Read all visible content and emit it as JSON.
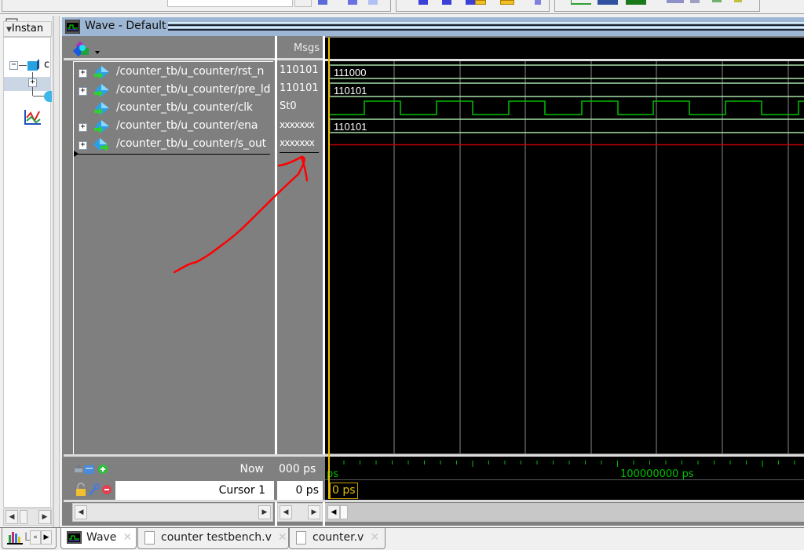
{
  "wave_window": {
    "title": "Wave - Default",
    "msgs_header": "Msgs"
  },
  "instance_panel": {
    "header": "Instan",
    "tree_items": [
      "c"
    ]
  },
  "signals": [
    {
      "name": "/counter_tb/u_counter/rst_n",
      "value": "110101",
      "expandable": true,
      "wave_type": "bus",
      "wave_label": "111000",
      "direction": "in"
    },
    {
      "name": "/counter_tb/u_counter/pre_ld",
      "value": "110101",
      "expandable": true,
      "wave_type": "bus",
      "wave_label": "110101",
      "direction": "in"
    },
    {
      "name": "/counter_tb/u_counter/clk",
      "value": "St0",
      "expandable": false,
      "wave_type": "clock",
      "wave_label": "",
      "direction": "in"
    },
    {
      "name": "/counter_tb/u_counter/ena",
      "value": "xxxxxxx",
      "expandable": true,
      "wave_type": "bus",
      "wave_label": "110101",
      "direction": "in"
    },
    {
      "name": "/counter_tb/u_counter/s_out",
      "value": "xxxxxxx",
      "expandable": true,
      "wave_type": "unknown",
      "wave_label": "",
      "direction": "out"
    }
  ],
  "cursor_area": {
    "now_label": "Now",
    "now_value": "000 ps",
    "cursor_label": "Cursor 1",
    "cursor_value": "0 ps",
    "cursor_tag": "0 ps"
  },
  "timeline": {
    "start_label": "ps",
    "mid_label": "100000000 ps"
  },
  "tabs": [
    {
      "label": "Wave",
      "active": true,
      "icon": "wave-icon"
    },
    {
      "label": "counter testbench.v",
      "active": false,
      "icon": "document-icon"
    },
    {
      "label": "counter.v",
      "active": false,
      "icon": "document-icon"
    }
  ],
  "left_tab": {
    "label": "L"
  },
  "colors": {
    "clock": "#00c000",
    "bus": "#a8e0a8",
    "unknown": "#c00000",
    "cursor": "#e8c000",
    "annotation": "#ff0000",
    "timeline_text": "#00c000"
  }
}
